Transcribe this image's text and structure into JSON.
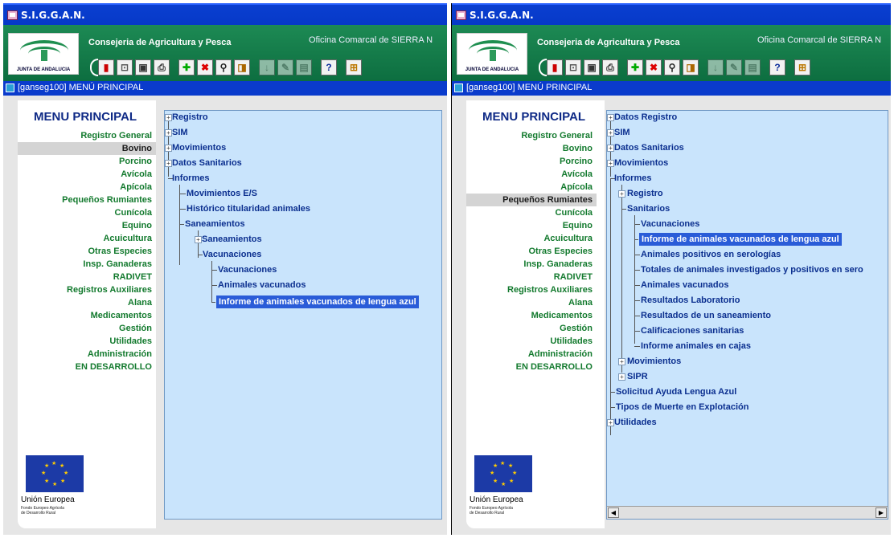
{
  "app": {
    "title": "S.I.G.G.A.N.",
    "consejeria": "Consejeria de Agricultura y Pesca",
    "oficina": "Oficina Comarcal de SIERRA N",
    "logo_text": "JUNTA DE ANDALUCIA"
  },
  "window": {
    "title": "[ganseg100] MENÚ PRINCIPAL"
  },
  "menu": {
    "title": "MENU PRINCIPAL",
    "items": [
      "Registro General",
      "Bovino",
      "Porcino",
      "Avícola",
      "Apícola",
      "Pequeños Rumiantes",
      "Cunícola",
      "Equino",
      "Acuicultura",
      "Otras Especies",
      "Insp. Ganaderas",
      "RADIVET",
      "Registros Auxiliares",
      "Alana",
      "Medicamentos",
      "Gestión",
      "Utilidades",
      "Administración",
      "EN DESARROLLO"
    ]
  },
  "left_panel": {
    "selected_menu": "Bovino",
    "tree": [
      "Registro",
      "SIM",
      "Movimientos",
      "Datos Sanitarios",
      "Informes",
      "Movimientos E/S",
      "Histórico titularidad animales",
      "Saneamientos",
      "Saneamientos",
      "Vacunaciones",
      "Vacunaciones",
      "Animales vacunados",
      "Informe de animales vacunados de lengua azul"
    ]
  },
  "right_panel": {
    "selected_menu": "Pequeños Rumiantes",
    "tree": [
      "Datos Registro",
      "SIM",
      "Datos Sanitarios",
      "Movimientos",
      "Informes",
      "Registro",
      "Sanitarios",
      "Vacunaciones",
      "Informe de animales vacunados de lengua azul",
      "Animales positivos en serologías",
      "Totales de animales investigados y positivos en sero",
      "Animales vacunados",
      "Resultados Laboratorio",
      "Resultados de un saneamiento",
      "Calificaciones sanitarias",
      "Informe animales en cajas",
      "Movimientos",
      "SIPR",
      "Solicitud Ayuda Lengua Azul",
      "Tipos de Muerte en Explotación",
      "Utilidades"
    ]
  },
  "eu": {
    "name": "Unión Europea",
    "fund_line1": "Fondo Europeo Agrícola",
    "fund_line2": "de Desarrollo Rural"
  },
  "toolbar_icons": [
    "exit-icon",
    "open-icon",
    "save-icon",
    "print-icon",
    "insert-icon",
    "delete-icon",
    "find-icon",
    "query-icon",
    "download-icon",
    "edit-icon",
    "form-icon",
    "help-icon",
    "network-icon"
  ],
  "colors": {
    "titlebar": "#0639c8",
    "band": "#0d6e40",
    "menu_text": "#137a2e",
    "tree_bg": "#c9e4fc",
    "tree_text": "#0b2f8f",
    "selection": "#2a5cd8"
  }
}
